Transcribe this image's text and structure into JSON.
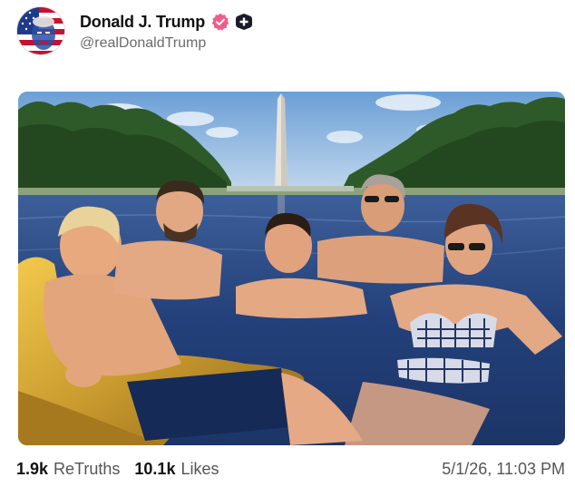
{
  "author": {
    "display_name": "Donald J. Trump",
    "handle": "@realDonaldTrump",
    "avatar_icon": "flag-portrait-avatar",
    "verified_icon": "verified-badge-icon",
    "plus_icon": "plus-badge-icon",
    "verified_color": "#f05c8c"
  },
  "post": {
    "image_icon": "pool-photo",
    "stats": [
      {
        "count": "1.9k",
        "label": "ReTruths"
      },
      {
        "count": "10.1k",
        "label": "Likes"
      }
    ],
    "timestamp": "5/1/26, 11:03 PM"
  }
}
